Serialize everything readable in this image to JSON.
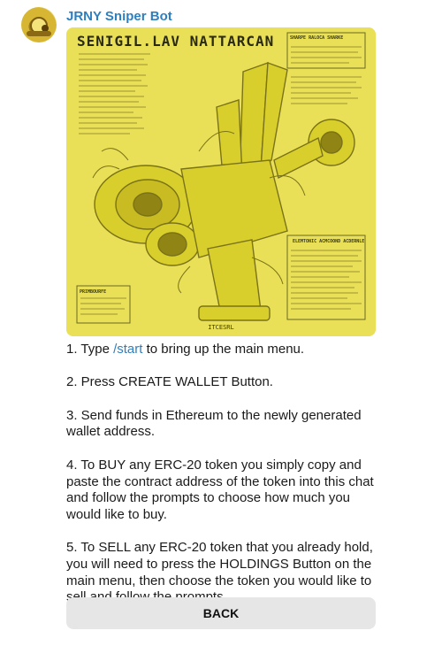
{
  "bot": {
    "name": "JRNY Sniper Bot",
    "avatar_icon": "bot-avatar-icon"
  },
  "image": {
    "title": "SENIGIL.LAV NATTARCAN",
    "header_text": "SHARPE RALOCA SHARKE",
    "right_label": "ELEMTONIC ACMCOOND ACDERNLE",
    "left_label": "PRIMBOURFE",
    "caption": "ITCESRL",
    "tint": "#e9e058"
  },
  "instructions": {
    "step1": {
      "before": "1. Type ",
      "link": "/start",
      "after": " to bring up the main menu."
    },
    "step2": "2. Press CREATE WALLET Button.",
    "step3": "3. Send funds in Ethereum to the newly generated wallet address.",
    "step4": "4. To BUY any ERC-20 token you simply copy and paste the contract address of the token into this chat and follow the prompts to choose how much you would like to buy.",
    "step5": "5. To SELL any ERC-20 token that you already hold, you will need to press the HOLDINGS Button on the main menu, then choose the token you would like to sell and follow the prompts."
  },
  "buttons": {
    "back": "BACK"
  },
  "colors": {
    "link": "#2f7fbf",
    "button_bg": "#e6e6e6"
  }
}
